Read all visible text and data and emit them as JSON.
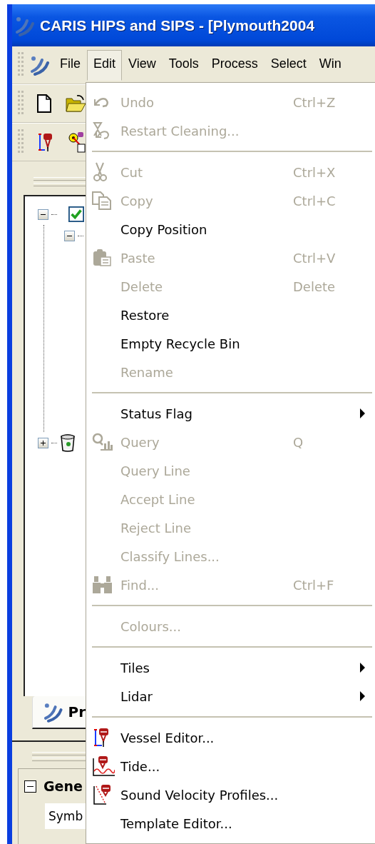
{
  "window": {
    "title": "CARIS HIPS and SIPS - [Plymouth2004"
  },
  "menubar": [
    {
      "label": "File",
      "selected": false
    },
    {
      "label": "Edit",
      "selected": true
    },
    {
      "label": "View",
      "selected": false
    },
    {
      "label": "Tools",
      "selected": false
    },
    {
      "label": "Process",
      "selected": false
    },
    {
      "label": "Select",
      "selected": false
    },
    {
      "label": "Win",
      "selected": false
    }
  ],
  "tree": [
    {
      "expanded": true,
      "checked": true,
      "children": [
        {
          "expanded": true
        }
      ]
    },
    {
      "expanded": false
    }
  ],
  "panel_tab": {
    "label": "Pr",
    "selected": true
  },
  "properties": {
    "group": "Gene",
    "expanded": true,
    "rows": [
      {
        "name": "Symb"
      }
    ]
  },
  "menu": [
    {
      "kind": "item",
      "label": "Undo",
      "shortcut": "Ctrl+Z",
      "disabled": true
    },
    {
      "kind": "item",
      "label": "Restart Cleaning...",
      "disabled": true
    },
    {
      "kind": "separator"
    },
    {
      "kind": "item",
      "label": "Cut",
      "shortcut": "Ctrl+X",
      "disabled": true
    },
    {
      "kind": "item",
      "label": "Copy",
      "shortcut": "Ctrl+C",
      "disabled": true
    },
    {
      "kind": "item",
      "label": "Copy Position",
      "disabled": false
    },
    {
      "kind": "item",
      "label": "Paste",
      "shortcut": "Ctrl+V",
      "disabled": true
    },
    {
      "kind": "item",
      "label": "Delete",
      "shortcut": "Delete",
      "disabled": true
    },
    {
      "kind": "item",
      "label": "Restore",
      "disabled": false
    },
    {
      "kind": "item",
      "label": "Empty Recycle Bin",
      "disabled": false
    },
    {
      "kind": "item",
      "label": "Rename",
      "disabled": true
    },
    {
      "kind": "separator"
    },
    {
      "kind": "item",
      "label": "Status Flag",
      "disabled": false,
      "submenu": true
    },
    {
      "kind": "item",
      "label": "Query",
      "shortcut": "Q",
      "disabled": true
    },
    {
      "kind": "item",
      "label": "Query Line",
      "disabled": true
    },
    {
      "kind": "item",
      "label": "Accept Line",
      "disabled": true
    },
    {
      "kind": "item",
      "label": "Reject Line",
      "disabled": true
    },
    {
      "kind": "item",
      "label": "Classify Lines...",
      "disabled": true
    },
    {
      "kind": "item",
      "label": "Find...",
      "shortcut": "Ctrl+F",
      "disabled": true
    },
    {
      "kind": "separator"
    },
    {
      "kind": "item",
      "label": "Colours...",
      "disabled": true
    },
    {
      "kind": "separator"
    },
    {
      "kind": "item",
      "label": "Tiles",
      "disabled": false,
      "submenu": true
    },
    {
      "kind": "item",
      "label": "Lidar",
      "disabled": false,
      "submenu": true
    },
    {
      "kind": "separator"
    },
    {
      "kind": "item",
      "label": "Vessel Editor...",
      "disabled": false
    },
    {
      "kind": "item",
      "label": "Tide...",
      "disabled": false
    },
    {
      "kind": "item",
      "label": "Sound Velocity Profiles...",
      "disabled": false
    },
    {
      "kind": "item",
      "label": "Template Editor...",
      "disabled": false
    }
  ]
}
